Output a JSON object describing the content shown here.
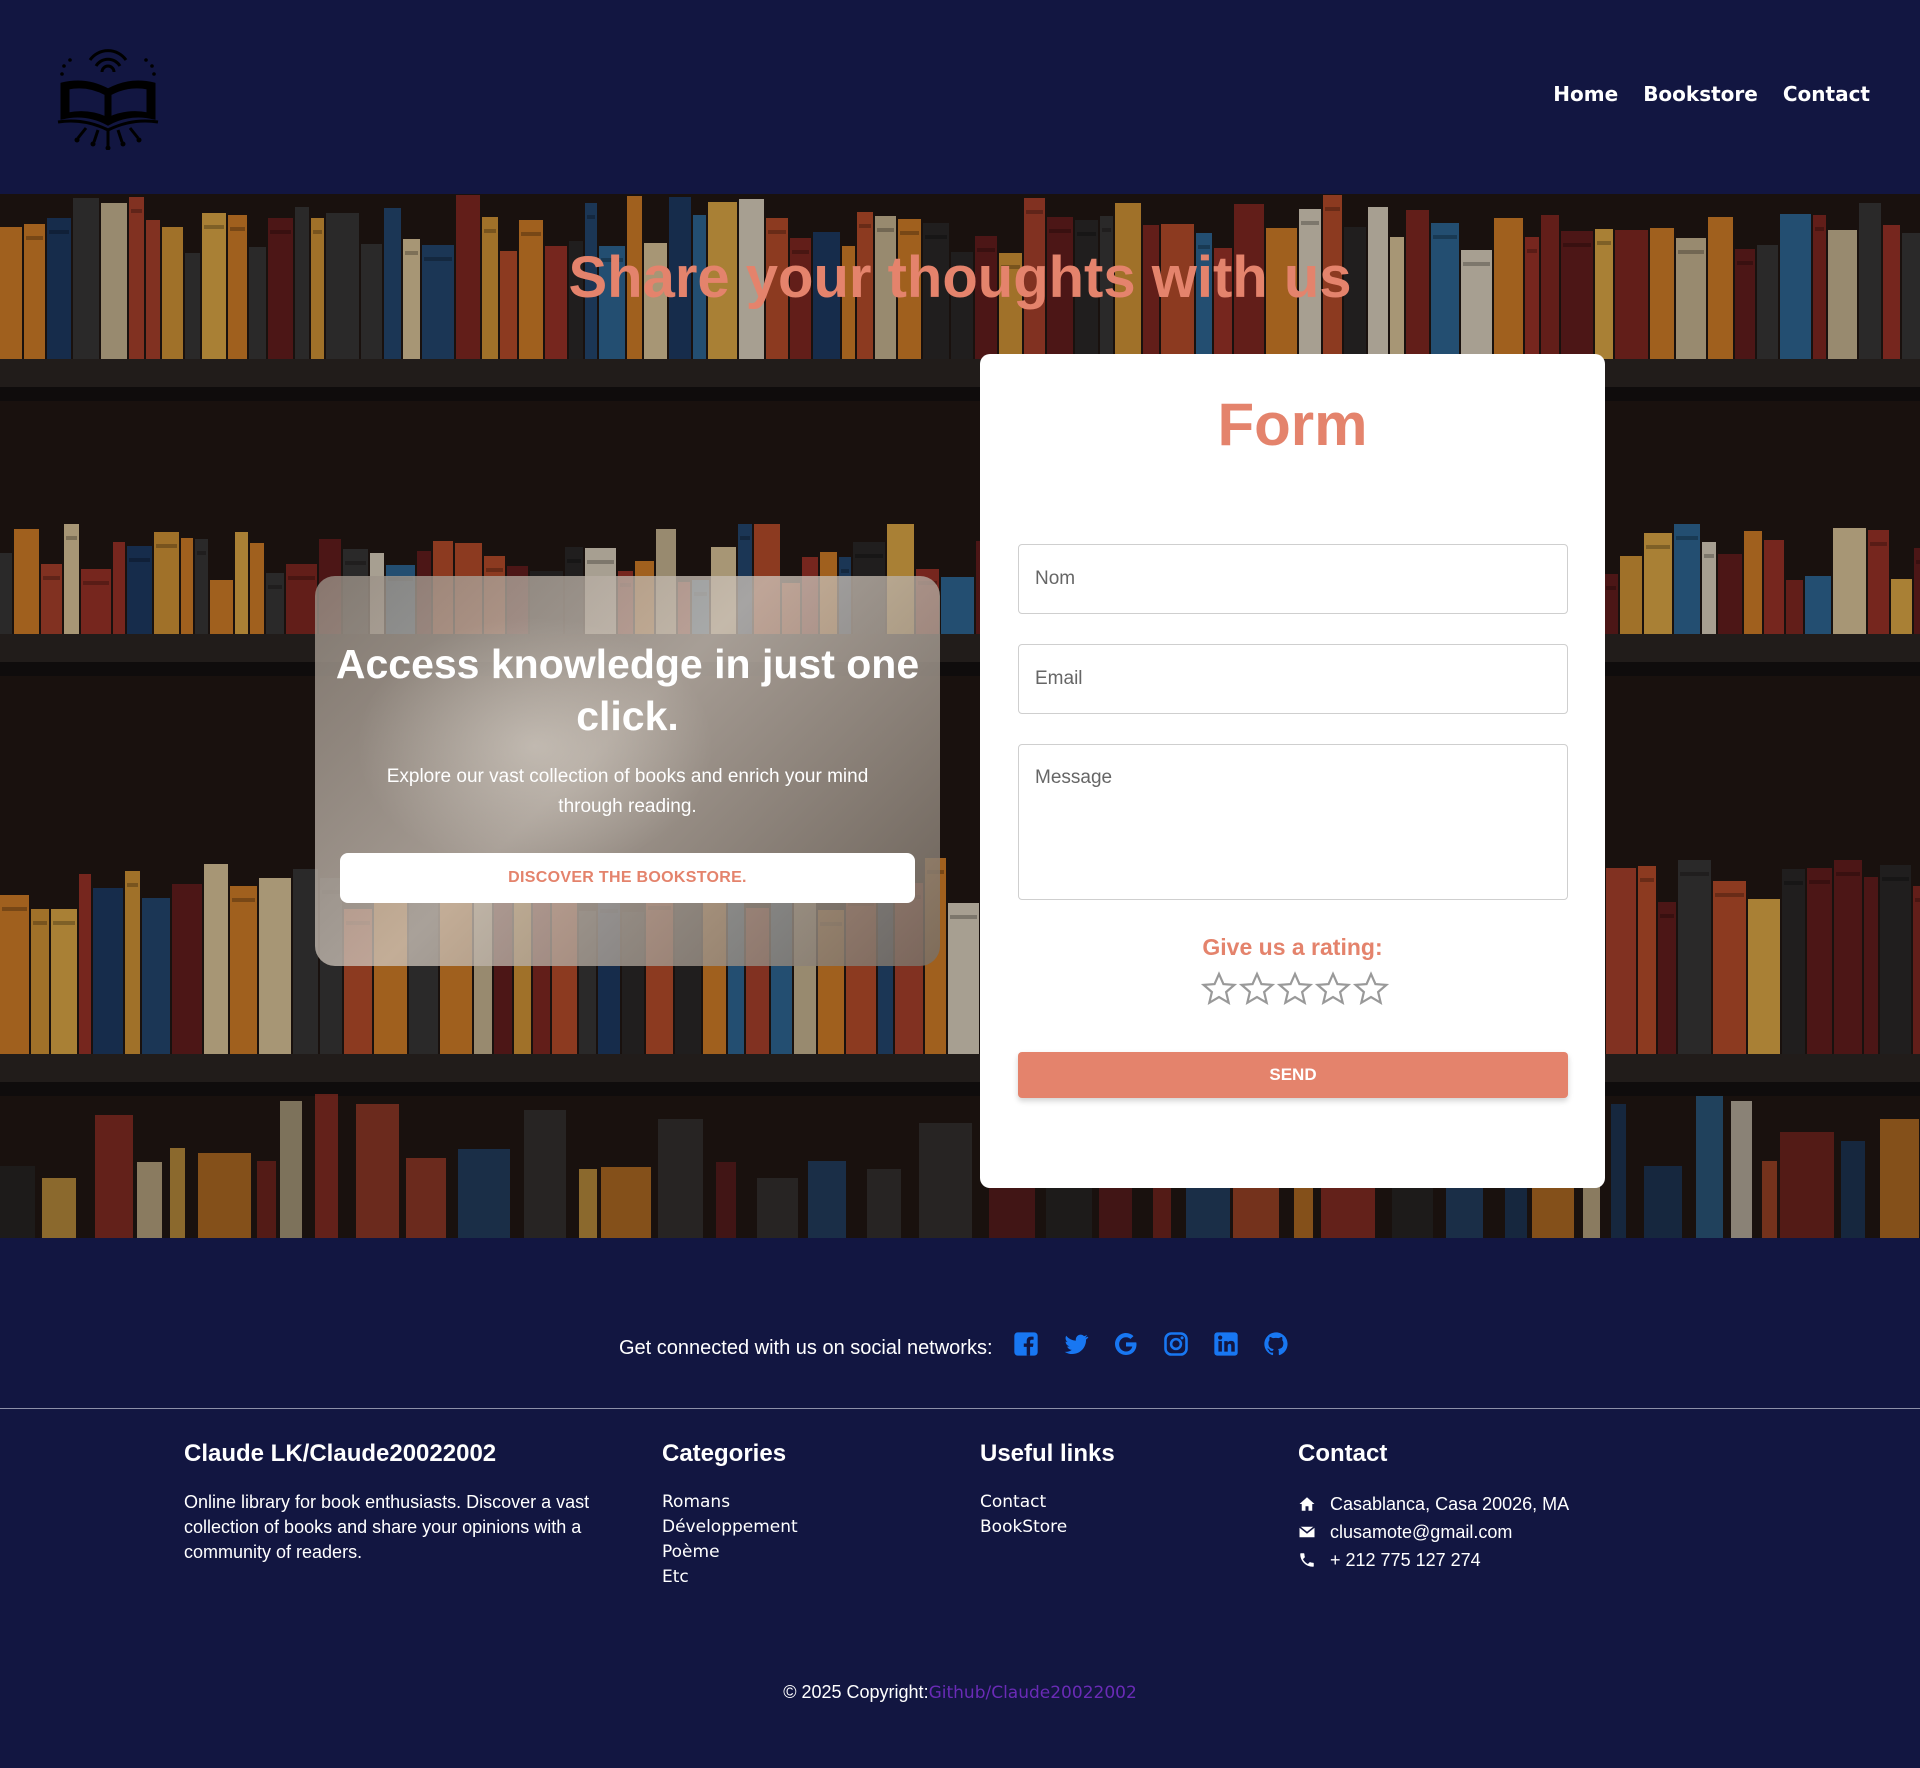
{
  "nav": {
    "links": [
      {
        "label": "Home"
      },
      {
        "label": "Bookstore"
      },
      {
        "label": "Contact"
      }
    ]
  },
  "hero": {
    "title": "Share your thoughts with us",
    "card": {
      "title": "Access knowledge in just one click.",
      "text": "Explore our vast collection of books and enrich your mind through reading.",
      "button": "DISCOVER THE BOOKSTORE."
    }
  },
  "form": {
    "title": "Form",
    "name_placeholder": "Nom",
    "email_placeholder": "Email",
    "message_placeholder": "Message",
    "rating_label": "Give us a rating:",
    "rating_value": 0,
    "rating_max": 5,
    "send": "SEND"
  },
  "social": {
    "text": "Get connected with us on social networks:",
    "icons": [
      "facebook-icon",
      "twitter-icon",
      "google-icon",
      "instagram-icon",
      "linkedin-icon",
      "github-icon"
    ]
  },
  "footer": {
    "about": {
      "title": "Claude LK/Claude20022002",
      "text": "Online library for book enthusiasts. Discover a vast collection of books and share your opinions with a community of readers."
    },
    "categories": {
      "title": "Categories",
      "items": [
        "Romans",
        "Développement",
        "Poème",
        "Etc"
      ]
    },
    "useful": {
      "title": "Useful links",
      "items": [
        "Contact",
        "BookStore"
      ]
    },
    "contact": {
      "title": "Contact",
      "address": "Casablanca, Casa 20026, MA",
      "email": "clusamote@gmail.com",
      "phone": "+ 212 775 127 274"
    },
    "copyright_text": "© 2025 Copyright:",
    "copyright_link": "Github/Claude20022002"
  },
  "colors": {
    "navy": "#121641",
    "accent": "#e4836c",
    "social_blue": "#1877f2",
    "copyright_link": "#6a2bb6"
  }
}
